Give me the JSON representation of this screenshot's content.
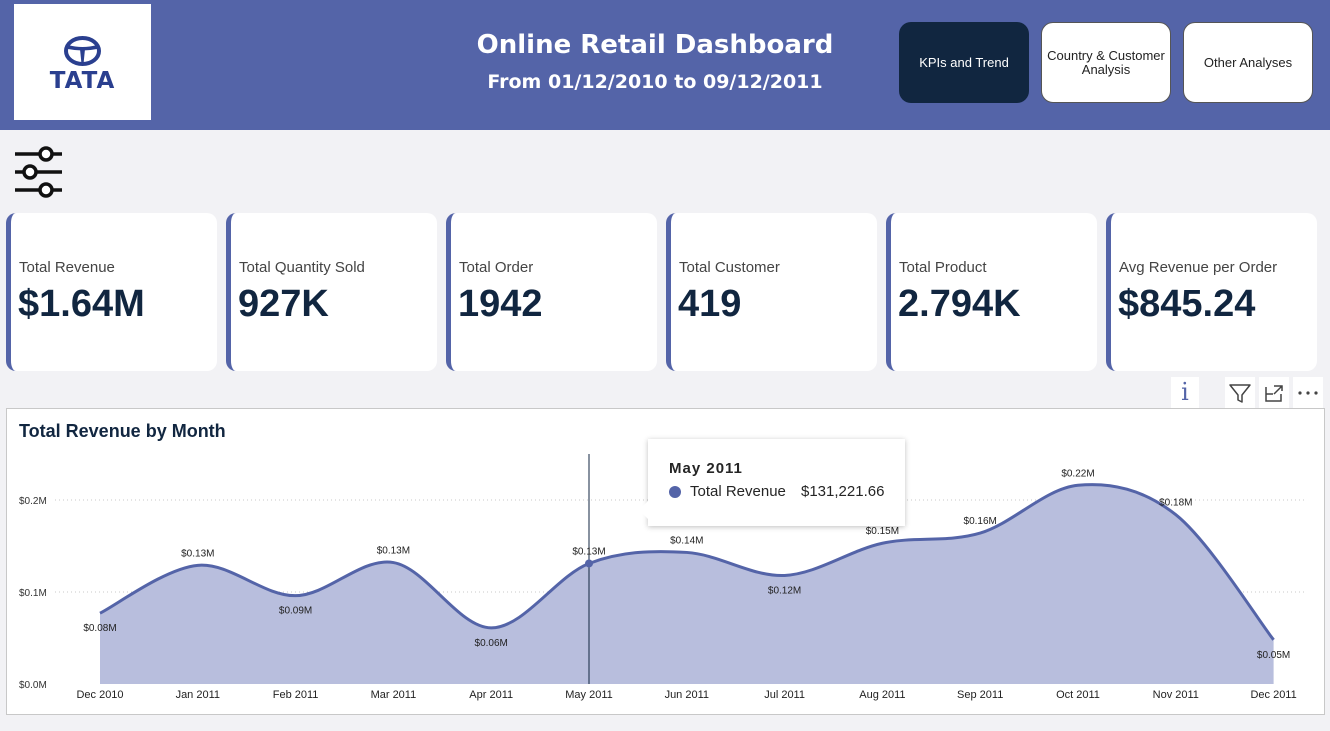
{
  "header": {
    "logo_text": "TATA",
    "title": "Online Retail Dashboard",
    "subtitle": "From 01/12/2010 to 09/12/2011",
    "bg_color": "#5464a8"
  },
  "nav": [
    {
      "label": "KPIs and Trend",
      "active": true
    },
    {
      "label": "Country & Customer Analysis",
      "active": false
    },
    {
      "label": "Other Analyses",
      "active": false
    }
  ],
  "filter_icon": "sliders-icon",
  "kpis": [
    {
      "label": "Total Revenue",
      "value": "$1.64M"
    },
    {
      "label": "Total Quantity Sold",
      "value": "927K"
    },
    {
      "label": "Total Order",
      "value": "1942"
    },
    {
      "label": "Total Customer",
      "value": "419"
    },
    {
      "label": "Total Product",
      "value": "2.794K"
    },
    {
      "label": "Avg Revenue per Order",
      "value": "$845.24"
    }
  ],
  "visual_toolbar": {
    "info_glyph": "i",
    "icons": [
      "info-icon",
      "filter-funnel-icon",
      "focus-mode-icon",
      "more-options-icon"
    ]
  },
  "chart_data": {
    "type": "area",
    "title": "Total Revenue by Month",
    "categories": [
      "Dec 2010",
      "Jan 2011",
      "Feb 2011",
      "Mar 2011",
      "Apr 2011",
      "May 2011",
      "Jun 2011",
      "Jul 2011",
      "Aug 2011",
      "Sep 2011",
      "Oct 2011",
      "Nov 2011",
      "Dec 2011"
    ],
    "series": [
      {
        "values": [
          0.077,
          0.129,
          0.096,
          0.132,
          0.061,
          0.131,
          0.143,
          0.118,
          0.153,
          0.164,
          0.216,
          0.184,
          0.048
        ],
        "labels": [
          "$0.08M",
          "$0.13M",
          "$0.09M",
          "$0.13M",
          "$0.06M",
          "$0.13M",
          "$0.14M",
          "$0.12M",
          "$0.15M",
          "$0.16M",
          "$0.22M",
          "$0.18M",
          "$0.05M"
        ]
      }
    ],
    "y_unit": "M",
    "ylim": [
      0,
      0.2
    ],
    "yticks": [
      "$0.0M",
      "$0.1M",
      "$0.2M"
    ],
    "grid": true,
    "line_color": "#5464a8",
    "fill_color": "#b8bedd",
    "highlight_index": 5
  },
  "tooltip": {
    "title": "May 2011",
    "series_label": "Total Revenue",
    "value": "$131,221.66"
  }
}
